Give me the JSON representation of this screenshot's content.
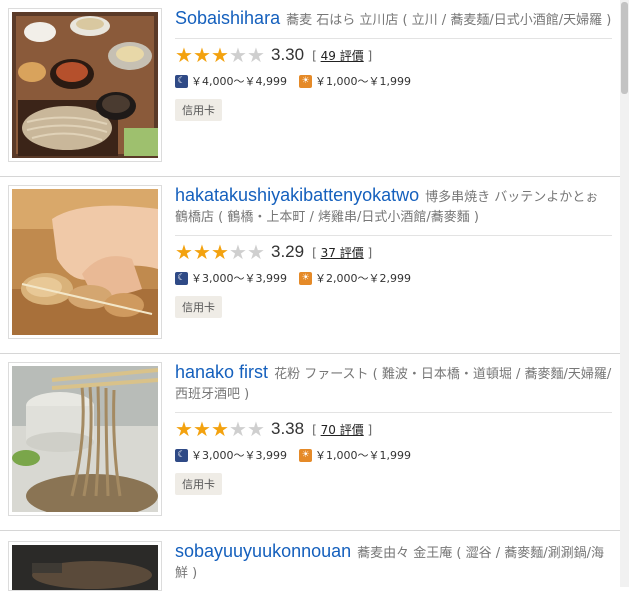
{
  "restaurants": [
    {
      "name": "Sobaishihara",
      "details": "蕎麦 石はら 立川店 ( 立川 / 蕎麦麺/日式小酒館/天婦羅 )",
      "score": "3.30",
      "stars_filled": 3,
      "reviews_prefix": "[",
      "reviews": "49 評價",
      "reviews_suffix": "]",
      "dinner_price": "￥4,000～￥4,999",
      "lunch_price": "￥1,000～￥1,999",
      "badge": "信用卡"
    },
    {
      "name": "hakatakushiyakibattenyokatwo",
      "details": "博多串焼き バッテンよかとぉ 鶴橋店 ( 鶴橋・上本町 / 烤雞串/日式小酒館/蕎麥麵 )",
      "score": "3.29",
      "stars_filled": 3,
      "reviews_prefix": "[",
      "reviews": "37 評價",
      "reviews_suffix": "]",
      "dinner_price": "￥3,000～￥3,999",
      "lunch_price": "￥2,000～￥2,999",
      "badge": "信用卡"
    },
    {
      "name": "hanako first",
      "details": "花粉 ファースト ( 難波・日本橋・道頓堀 / 蕎麥麵/天婦羅/西班牙酒吧 )",
      "score": "3.38",
      "stars_filled": 3,
      "reviews_prefix": "[",
      "reviews": "70 評價",
      "reviews_suffix": "]",
      "dinner_price": "￥3,000～￥3,999",
      "lunch_price": "￥1,000～￥1,999",
      "badge": "信用卡"
    },
    {
      "name": "sobayuuyuukonnouan",
      "details": "蕎麦由々 金王庵 ( 澀谷 / 蕎麥麵/涮涮鍋/海鮮 )"
    }
  ],
  "icons": {
    "star_filled": "★",
    "star_empty": "★",
    "dinner": "moon-icon",
    "lunch": "sun-icon"
  },
  "colors": {
    "link": "#1560bd",
    "star": "#f3a20f",
    "star_empty": "#cfcfcf",
    "dinner_icon": "#2f4a86",
    "lunch_icon": "#e58a28"
  }
}
